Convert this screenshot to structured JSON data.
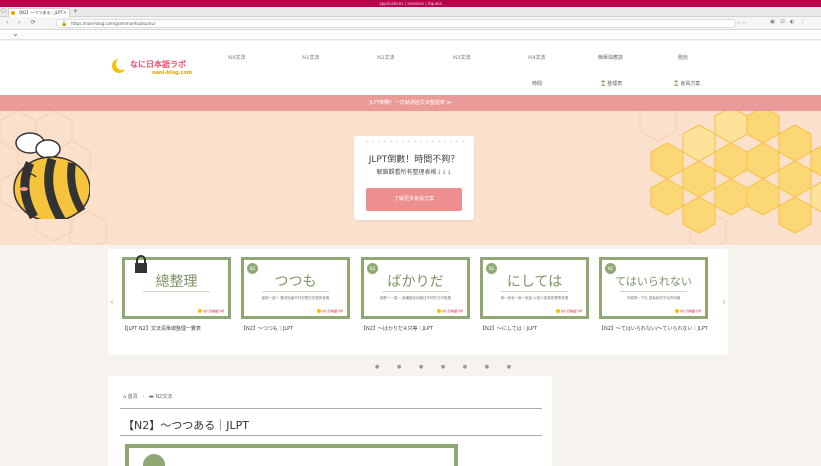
{
  "os_bar": {
    "title": "applications | sessions | Aqueia"
  },
  "browser": {
    "tab_title": "【N2】～つつある｜JLPT",
    "new_tab_symbol": "+",
    "url": "https://nani-blog.com/grammar/tsutsuaru/",
    "url_right": "☆ ☆"
  },
  "site": {
    "logo_jp": "なに日本語ラボ",
    "logo_en": "nani-blog.com",
    "nav": [
      "N0文法",
      "N1文法",
      "N2文法",
      "N3文法",
      "N4文法",
      "簡單與應該",
      "時間",
      "整理表",
      "會員方案"
    ],
    "nav_extra": "題玩",
    "announcement": "JLPT倒數！一次就通過文法整理表 ≫"
  },
  "hero": {
    "title": "JLPT倒數！時間不夠？",
    "subtitle": "解鎖觀看所有整理表格↓↓↓",
    "button": "了解更多會員方案"
  },
  "carousel": {
    "cards": [
      {
        "badge": "",
        "big": "總整理",
        "small": "",
        "caption": "【JLPT N2】文法清單總整理一覽表"
      },
      {
        "badge": "N2",
        "big": "つつも",
        "small": "趨勢一起～  雖然知道不好但是仍在做的事情",
        "caption": "【N2】～つつも｜JLPT"
      },
      {
        "badge": "N2",
        "big": "ばかりだ",
        "small": "越發～一直～  某種變化持續往不好的方向發展",
        "caption": "【N2】～ばかりだ④只等｜JLPT"
      },
      {
        "badge": "N2",
        "big": "にしては",
        "small": "就～而言～就～來說  以某人某事的標準來看",
        "caption": "【N2】～にしては｜JLPT"
      },
      {
        "badge": "N2",
        "big": "てはいられない",
        "small": "不能再～下去  因為狀況不允許持續",
        "caption": "【N2】～てはいられない/～ていられない｜JLPT"
      }
    ],
    "dots": "● ● ● ● ● ● ●"
  },
  "article": {
    "breadcrumb_home": "首頁",
    "breadcrumb_cat": "N2文法",
    "title": "【N2】～つつある｜JLPT"
  },
  "colors": {
    "accent_pink": "#ea9a98",
    "accent_green": "#8fa874",
    "os_bar": "#b8004a"
  }
}
